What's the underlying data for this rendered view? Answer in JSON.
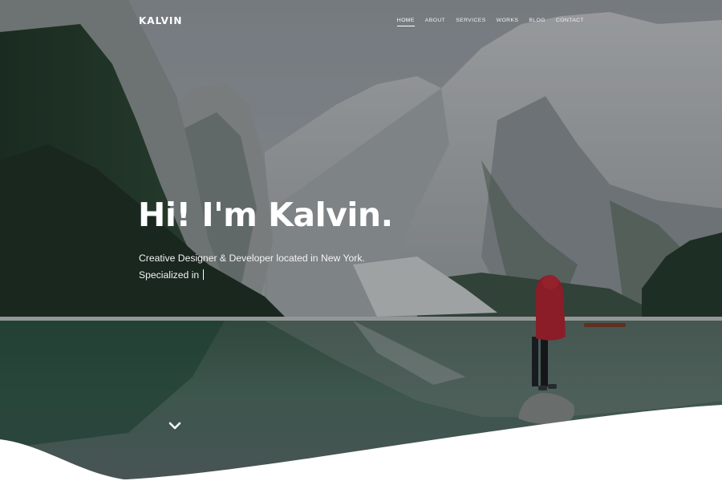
{
  "brand": {
    "logo": "KALVIN"
  },
  "nav": {
    "items": [
      {
        "label": "HOME",
        "active": true
      },
      {
        "label": "ABOUT",
        "active": false
      },
      {
        "label": "SERVICES",
        "active": false
      },
      {
        "label": "WORKS",
        "active": false
      },
      {
        "label": "BLOG",
        "active": false
      },
      {
        "label": "CONTACT",
        "active": false
      }
    ]
  },
  "hero": {
    "headline": "Hi! I'm Kalvin.",
    "subline_1": "Creative Designer & Developer located in New York.",
    "subline_2": "Specialized in",
    "scroll_icon": "chevron-down-icon"
  },
  "colors": {
    "overlay": "#14181c",
    "accent_red": "#c0182a",
    "text": "#ffffff",
    "wave": "#ffffff"
  }
}
